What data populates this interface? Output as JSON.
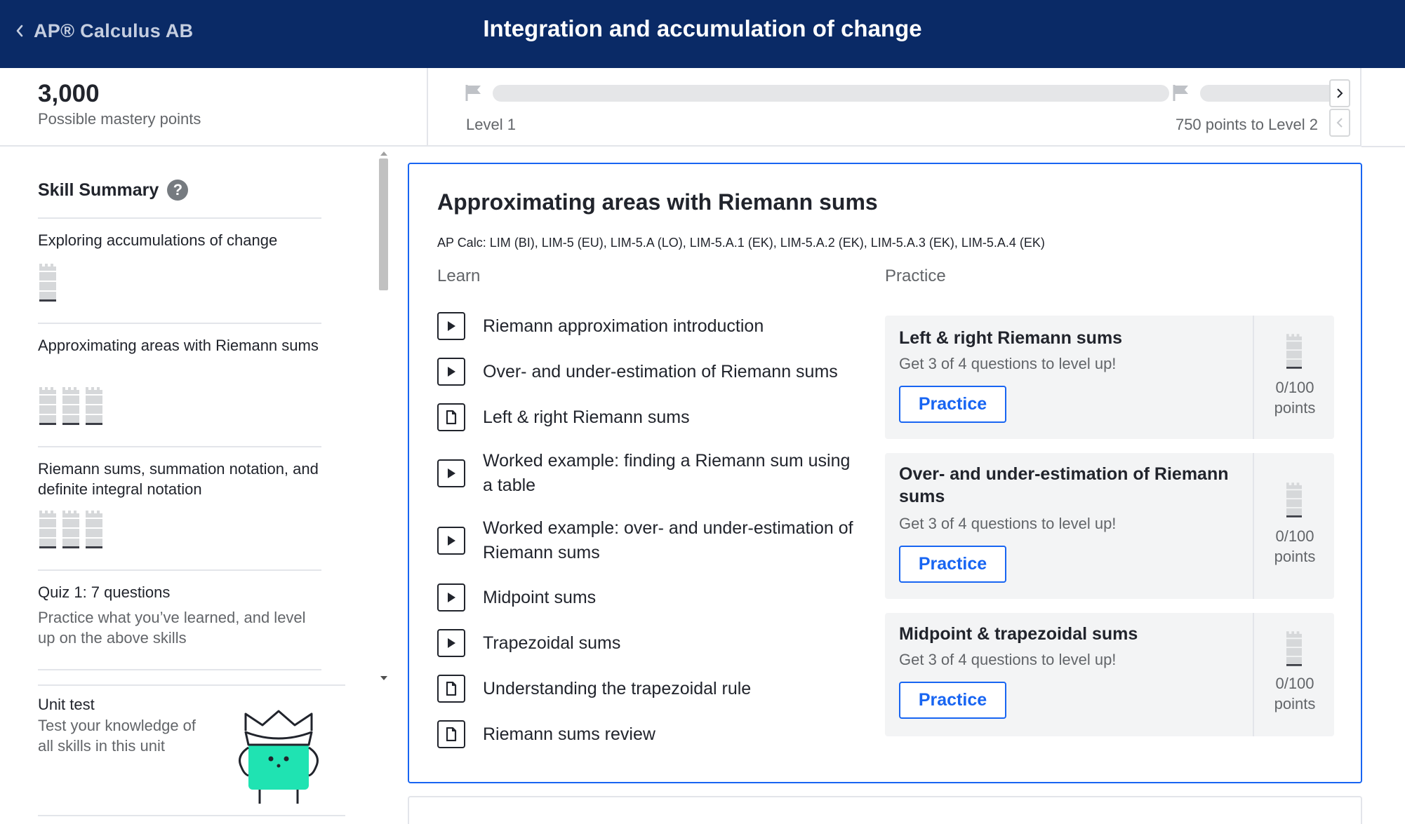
{
  "header": {
    "back_label": "AP® Calculus AB",
    "title": "Integration and accumulation of change"
  },
  "mastery": {
    "points": "3,000",
    "caption": "Possible mastery points",
    "level_label": "Level 1",
    "next_level_label": "750 points to Level 2",
    "progress": 0
  },
  "sidebar": {
    "heading": "Skill Summary",
    "items": [
      {
        "title": "Exploring accumulations of change",
        "skills": 1
      },
      {
        "title": "Approximating areas with Riemann sums",
        "skills": 3
      },
      {
        "title": "Riemann sums, summation notation, and definite integral notation",
        "skills": 3
      },
      {
        "title": "Quiz 1: 7 questions",
        "desc": "Practice what you’ve learned, and level up on the above skills"
      }
    ],
    "unit_test": {
      "title": "Unit test",
      "desc": "Test your knowledge of all skills in this unit"
    }
  },
  "lesson": {
    "title": "Approximating areas with Riemann sums",
    "standards": "AP Calc: LIM (BI), LIM-5 (EU), LIM-5.A (LO), LIM-5.A.1 (EK), LIM-5.A.2 (EK), LIM-5.A.3 (EK), LIM-5.A.4 (EK)",
    "learn_heading": "Learn",
    "practice_heading": "Practice",
    "learn_items": [
      {
        "label": "Riemann approximation introduction",
        "icon": "video-play-icon"
      },
      {
        "label": "Over- and under-estimation of Riemann sums",
        "icon": "video-play-icon"
      },
      {
        "label": "Left & right Riemann sums",
        "icon": "article-icon"
      },
      {
        "label": "Worked example: finding a Riemann sum using a table",
        "icon": "video-play-icon"
      },
      {
        "label": "Worked example: over- and under-estimation of Riemann sums",
        "icon": "video-play-icon"
      },
      {
        "label": "Midpoint sums",
        "icon": "video-play-icon"
      },
      {
        "label": "Trapezoidal sums",
        "icon": "video-play-icon"
      },
      {
        "label": "Understanding the trapezoidal rule",
        "icon": "article-icon"
      },
      {
        "label": "Riemann sums review",
        "icon": "article-icon"
      }
    ],
    "practice_items": [
      {
        "title": "Left & right Riemann sums",
        "desc": "Get 3 of 4 questions to level up!",
        "button": "Practice",
        "points": "0/100",
        "points_unit": "points"
      },
      {
        "title": "Over- and under-estimation of Riemann sums",
        "desc": "Get 3 of 4 questions to level up!",
        "button": "Practice",
        "points": "0/100",
        "points_unit": "points"
      },
      {
        "title": "Midpoint & trapezoidal sums",
        "desc": "Get 3 of 4 questions to level up!",
        "button": "Practice",
        "points": "0/100",
        "points_unit": "points"
      }
    ]
  },
  "colors": {
    "header_bg": "#0a2a66",
    "accent": "#1865f2",
    "mascot": "#1fe3b2"
  }
}
